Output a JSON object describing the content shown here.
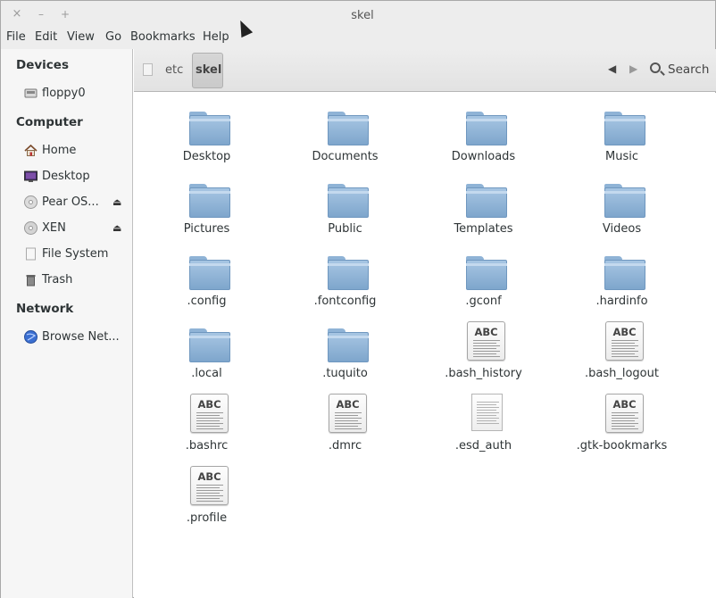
{
  "window": {
    "title": "skel"
  },
  "window_buttons": {
    "close": "×",
    "minimize": "–",
    "maximize": "+"
  },
  "menu": [
    "File",
    "Edit",
    "View",
    "Go",
    "Bookmarks",
    "Help"
  ],
  "sidebar": {
    "sections": [
      {
        "heading": "Devices",
        "items": [
          {
            "label": "floppy0",
            "icon": "floppy-icon",
            "eject": false
          }
        ]
      },
      {
        "heading": "Computer",
        "items": [
          {
            "label": "Home",
            "icon": "home-icon",
            "eject": false
          },
          {
            "label": "Desktop",
            "icon": "desktop-icon",
            "eject": false
          },
          {
            "label": "Pear OS...",
            "icon": "optical-disc-icon",
            "eject": true
          },
          {
            "label": "XEN",
            "icon": "drive-icon",
            "eject": true
          },
          {
            "label": "File System",
            "icon": "filesystem-icon",
            "eject": false
          },
          {
            "label": "Trash",
            "icon": "trash-icon",
            "eject": false
          }
        ]
      },
      {
        "heading": "Network",
        "items": [
          {
            "label": "Browse Net...",
            "icon": "network-globe-icon",
            "eject": false
          }
        ]
      }
    ],
    "eject_glyph": "⏏"
  },
  "pathbar": {
    "segments": [
      "etc",
      "skel"
    ],
    "active": "skel"
  },
  "toolbar": {
    "back_glyph": "◀",
    "forward_glyph": "▶",
    "search_label": "Search"
  },
  "files": [
    {
      "name": "Desktop",
      "type": "folder"
    },
    {
      "name": "Documents",
      "type": "folder"
    },
    {
      "name": "Downloads",
      "type": "folder"
    },
    {
      "name": "Music",
      "type": "folder"
    },
    {
      "name": "Pictures",
      "type": "folder"
    },
    {
      "name": "Public",
      "type": "folder"
    },
    {
      "name": "Templates",
      "type": "folder"
    },
    {
      "name": "Videos",
      "type": "folder"
    },
    {
      "name": ".config",
      "type": "folder"
    },
    {
      "name": ".fontconfig",
      "type": "folder"
    },
    {
      "name": ".gconf",
      "type": "folder"
    },
    {
      "name": ".hardinfo",
      "type": "folder"
    },
    {
      "name": ".local",
      "type": "folder"
    },
    {
      "name": ".tuquito",
      "type": "folder"
    },
    {
      "name": ".bash_history",
      "type": "text"
    },
    {
      "name": ".bash_logout",
      "type": "text"
    },
    {
      "name": ".bashrc",
      "type": "text"
    },
    {
      "name": ".dmrc",
      "type": "text"
    },
    {
      "name": ".esd_auth",
      "type": "plain"
    },
    {
      "name": ".gtk-bookmarks",
      "type": "text"
    },
    {
      "name": ".profile",
      "type": "text"
    }
  ],
  "text_icon_label": "ABC"
}
